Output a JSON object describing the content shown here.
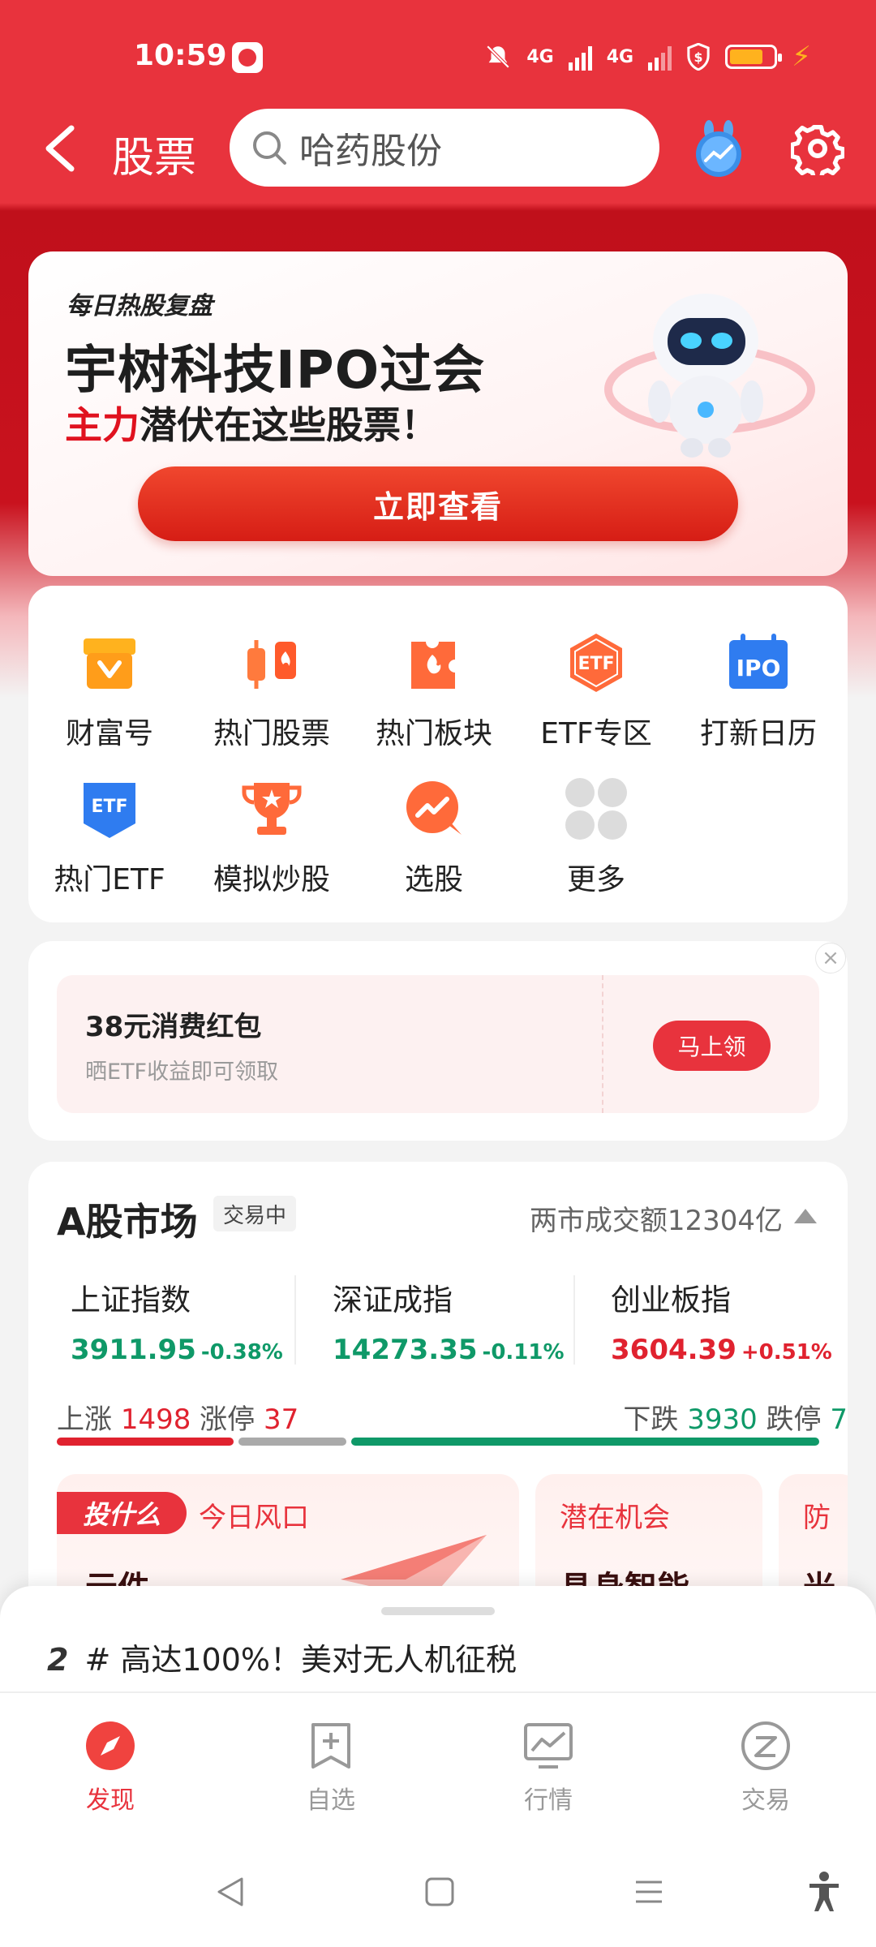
{
  "status_bar": {
    "time": "10:59",
    "net1": "4G",
    "net2": "4G"
  },
  "header": {
    "title": "股票",
    "search_placeholder": "哈药股份"
  },
  "banner": {
    "tag": "每日热股复盘",
    "title": "宇树科技IPO过会",
    "sub_red": "主力",
    "sub_rest": "潜伏在这些股票！",
    "cta": "立即查看"
  },
  "quick": {
    "items": [
      {
        "label": "财富号",
        "icon": "store-icon"
      },
      {
        "label": "热门股票",
        "icon": "hot-stocks-icon"
      },
      {
        "label": "热门板块",
        "icon": "hot-sector-icon"
      },
      {
        "label": "ETF专区",
        "icon": "etf-zone-icon"
      },
      {
        "label": "打新日历",
        "icon": "ipo-calendar-icon"
      },
      {
        "label": "热门ETF",
        "icon": "hot-etf-icon"
      },
      {
        "label": "模拟炒股",
        "icon": "trophy-icon"
      },
      {
        "label": "选股",
        "icon": "stock-picker-icon"
      },
      {
        "label": "更多",
        "icon": "more-icon"
      }
    ],
    "etf_text": "ETF",
    "ipo_text": "IPO"
  },
  "packet": {
    "title": "38元消费红包",
    "desc": "晒ETF收益即可领取",
    "button": "马上领",
    "close": "×"
  },
  "market": {
    "title": "A股市场",
    "status": "交易中",
    "volume": "两市成交额12304亿",
    "indices": [
      {
        "name": "上证指数",
        "value": "3911.95",
        "change": "-0.38%"
      },
      {
        "name": "深证成指",
        "value": "14273.35",
        "change": "-0.11%"
      },
      {
        "name": "创业板指",
        "value": "3604.39",
        "change": "+0.51%"
      }
    ],
    "up_label": "上涨",
    "up_count": "1498",
    "limit_up_label": "涨停",
    "limit_up_count": "37",
    "down_label": "下跌",
    "down_count": "3930",
    "limit_down_label": "跌停",
    "limit_down_count": "7",
    "cards": [
      {
        "badge": "投什么",
        "tag": "今日风口",
        "title": "元件"
      },
      {
        "tag": "潜在机会",
        "title": "具身智能"
      },
      {
        "tag": "防",
        "title": "光"
      }
    ]
  },
  "ticker": {
    "rank": "2",
    "text": "# 高达100%！美对无人机征税"
  },
  "bottom_nav": [
    {
      "label": "发现",
      "icon": "compass-icon",
      "active": true
    },
    {
      "label": "自选",
      "icon": "watchlist-icon",
      "active": false
    },
    {
      "label": "行情",
      "icon": "market-chart-icon",
      "active": false
    },
    {
      "label": "交易",
      "icon": "trade-icon",
      "active": false
    }
  ],
  "colors": {
    "brand_red": "#e8333d",
    "up": "#e0222f",
    "down": "#0f9968"
  }
}
